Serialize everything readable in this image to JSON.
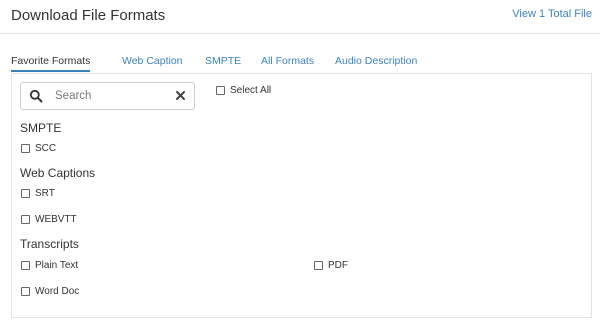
{
  "header": {
    "title": "Download File Formats",
    "view_total": "View 1 Total File"
  },
  "tabs": [
    {
      "label": "Favorite Formats",
      "active": true
    },
    {
      "label": "Web Caption",
      "active": false
    },
    {
      "label": "SMPTE",
      "active": false
    },
    {
      "label": "All Formats",
      "active": false
    },
    {
      "label": "Audio Description",
      "active": false
    }
  ],
  "search": {
    "placeholder": "Search",
    "value": ""
  },
  "select_all": {
    "label": "Select All",
    "checked": false
  },
  "sections": [
    {
      "title": "SMPTE",
      "items": [
        {
          "label": "SCC",
          "checked": false
        }
      ]
    },
    {
      "title": "Web Captions",
      "items": [
        {
          "label": "SRT",
          "checked": false
        },
        {
          "label": "WEBVTT",
          "checked": false
        }
      ]
    },
    {
      "title": "Transcripts",
      "items": [
        {
          "label": "Plain Text",
          "checked": false
        },
        {
          "label": "PDF",
          "checked": false
        },
        {
          "label": "Word Doc",
          "checked": false
        }
      ]
    }
  ],
  "colors": {
    "link": "#3b83c0",
    "text": "#333333",
    "border": "#e3e3e3"
  }
}
